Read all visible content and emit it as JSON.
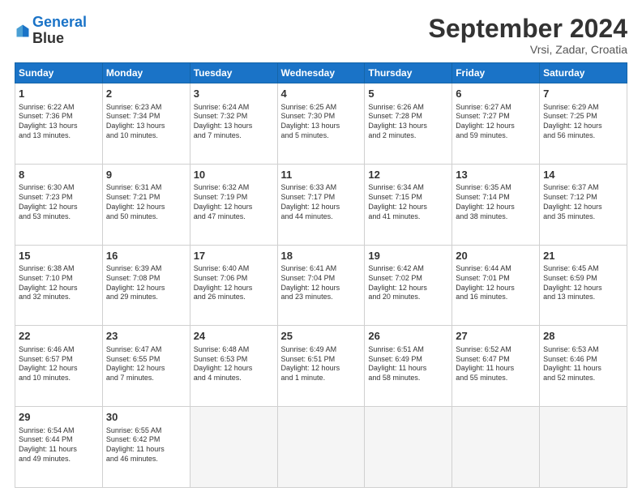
{
  "header": {
    "logo_line1": "General",
    "logo_line2": "Blue",
    "month": "September 2024",
    "location": "Vrsi, Zadar, Croatia"
  },
  "weekdays": [
    "Sunday",
    "Monday",
    "Tuesday",
    "Wednesday",
    "Thursday",
    "Friday",
    "Saturday"
  ],
  "weeks": [
    [
      {
        "day": "1",
        "info": "Sunrise: 6:22 AM\nSunset: 7:36 PM\nDaylight: 13 hours\nand 13 minutes."
      },
      {
        "day": "2",
        "info": "Sunrise: 6:23 AM\nSunset: 7:34 PM\nDaylight: 13 hours\nand 10 minutes."
      },
      {
        "day": "3",
        "info": "Sunrise: 6:24 AM\nSunset: 7:32 PM\nDaylight: 13 hours\nand 7 minutes."
      },
      {
        "day": "4",
        "info": "Sunrise: 6:25 AM\nSunset: 7:30 PM\nDaylight: 13 hours\nand 5 minutes."
      },
      {
        "day": "5",
        "info": "Sunrise: 6:26 AM\nSunset: 7:28 PM\nDaylight: 13 hours\nand 2 minutes."
      },
      {
        "day": "6",
        "info": "Sunrise: 6:27 AM\nSunset: 7:27 PM\nDaylight: 12 hours\nand 59 minutes."
      },
      {
        "day": "7",
        "info": "Sunrise: 6:29 AM\nSunset: 7:25 PM\nDaylight: 12 hours\nand 56 minutes."
      }
    ],
    [
      {
        "day": "8",
        "info": "Sunrise: 6:30 AM\nSunset: 7:23 PM\nDaylight: 12 hours\nand 53 minutes."
      },
      {
        "day": "9",
        "info": "Sunrise: 6:31 AM\nSunset: 7:21 PM\nDaylight: 12 hours\nand 50 minutes."
      },
      {
        "day": "10",
        "info": "Sunrise: 6:32 AM\nSunset: 7:19 PM\nDaylight: 12 hours\nand 47 minutes."
      },
      {
        "day": "11",
        "info": "Sunrise: 6:33 AM\nSunset: 7:17 PM\nDaylight: 12 hours\nand 44 minutes."
      },
      {
        "day": "12",
        "info": "Sunrise: 6:34 AM\nSunset: 7:15 PM\nDaylight: 12 hours\nand 41 minutes."
      },
      {
        "day": "13",
        "info": "Sunrise: 6:35 AM\nSunset: 7:14 PM\nDaylight: 12 hours\nand 38 minutes."
      },
      {
        "day": "14",
        "info": "Sunrise: 6:37 AM\nSunset: 7:12 PM\nDaylight: 12 hours\nand 35 minutes."
      }
    ],
    [
      {
        "day": "15",
        "info": "Sunrise: 6:38 AM\nSunset: 7:10 PM\nDaylight: 12 hours\nand 32 minutes."
      },
      {
        "day": "16",
        "info": "Sunrise: 6:39 AM\nSunset: 7:08 PM\nDaylight: 12 hours\nand 29 minutes."
      },
      {
        "day": "17",
        "info": "Sunrise: 6:40 AM\nSunset: 7:06 PM\nDaylight: 12 hours\nand 26 minutes."
      },
      {
        "day": "18",
        "info": "Sunrise: 6:41 AM\nSunset: 7:04 PM\nDaylight: 12 hours\nand 23 minutes."
      },
      {
        "day": "19",
        "info": "Sunrise: 6:42 AM\nSunset: 7:02 PM\nDaylight: 12 hours\nand 20 minutes."
      },
      {
        "day": "20",
        "info": "Sunrise: 6:44 AM\nSunset: 7:01 PM\nDaylight: 12 hours\nand 16 minutes."
      },
      {
        "day": "21",
        "info": "Sunrise: 6:45 AM\nSunset: 6:59 PM\nDaylight: 12 hours\nand 13 minutes."
      }
    ],
    [
      {
        "day": "22",
        "info": "Sunrise: 6:46 AM\nSunset: 6:57 PM\nDaylight: 12 hours\nand 10 minutes."
      },
      {
        "day": "23",
        "info": "Sunrise: 6:47 AM\nSunset: 6:55 PM\nDaylight: 12 hours\nand 7 minutes."
      },
      {
        "day": "24",
        "info": "Sunrise: 6:48 AM\nSunset: 6:53 PM\nDaylight: 12 hours\nand 4 minutes."
      },
      {
        "day": "25",
        "info": "Sunrise: 6:49 AM\nSunset: 6:51 PM\nDaylight: 12 hours\nand 1 minute."
      },
      {
        "day": "26",
        "info": "Sunrise: 6:51 AM\nSunset: 6:49 PM\nDaylight: 11 hours\nand 58 minutes."
      },
      {
        "day": "27",
        "info": "Sunrise: 6:52 AM\nSunset: 6:47 PM\nDaylight: 11 hours\nand 55 minutes."
      },
      {
        "day": "28",
        "info": "Sunrise: 6:53 AM\nSunset: 6:46 PM\nDaylight: 11 hours\nand 52 minutes."
      }
    ],
    [
      {
        "day": "29",
        "info": "Sunrise: 6:54 AM\nSunset: 6:44 PM\nDaylight: 11 hours\nand 49 minutes."
      },
      {
        "day": "30",
        "info": "Sunrise: 6:55 AM\nSunset: 6:42 PM\nDaylight: 11 hours\nand 46 minutes."
      },
      {
        "day": "",
        "info": ""
      },
      {
        "day": "",
        "info": ""
      },
      {
        "day": "",
        "info": ""
      },
      {
        "day": "",
        "info": ""
      },
      {
        "day": "",
        "info": ""
      }
    ]
  ]
}
